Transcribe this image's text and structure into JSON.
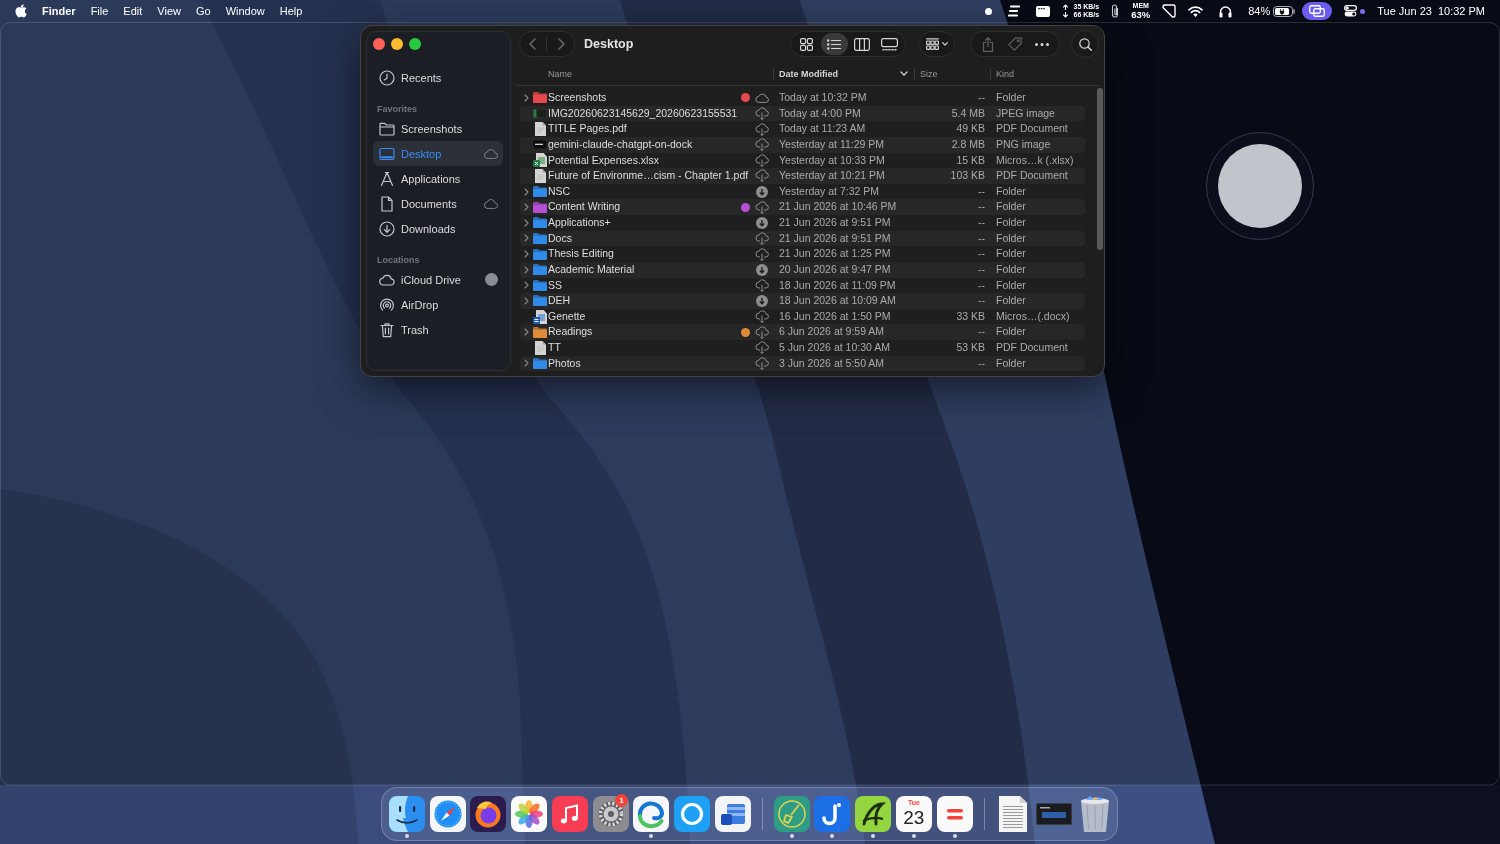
{
  "menu_bar": {
    "menus": [
      {
        "label": "Finder",
        "kind": "app"
      },
      {
        "label": "File",
        "kind": "menu"
      },
      {
        "label": "Edit",
        "kind": "menu"
      },
      {
        "label": "View",
        "kind": "menu"
      },
      {
        "label": "Go",
        "kind": "menu"
      },
      {
        "label": "Window",
        "kind": "menu"
      },
      {
        "label": "Help",
        "kind": "menu"
      }
    ],
    "status": {
      "network": {
        "upload": "35 KB/s",
        "download": "66 KB/s"
      },
      "memory": {
        "label": "MEM",
        "value": "63%"
      },
      "battery": {
        "percent": "84%",
        "charging": true
      },
      "mirroring": {
        "active": true
      },
      "date": "Tue Jun 23",
      "time": "10:32 PM"
    }
  },
  "window": {
    "title": "Desktop",
    "view_modes": [
      {
        "kind": "icons",
        "selected": false
      },
      {
        "kind": "list",
        "selected": true
      },
      {
        "kind": "columns",
        "selected": false
      },
      {
        "kind": "gallery",
        "selected": false
      }
    ]
  },
  "sidebar": {
    "sections": [
      {
        "items": [
          {
            "label": "Recents",
            "kind": "recents",
            "selected": false
          }
        ]
      },
      {
        "header": "Favorites",
        "items": [
          {
            "label": "Screenshots",
            "kind": "folder",
            "selected": false
          },
          {
            "label": "Desktop",
            "kind": "desktop",
            "selected": true,
            "badge": {
              "kind": "cloud"
            }
          },
          {
            "label": "Applications",
            "kind": "applications",
            "selected": false
          },
          {
            "label": "Documents",
            "kind": "documents",
            "selected": false,
            "badge": {
              "kind": "cloud"
            }
          },
          {
            "label": "Downloads",
            "kind": "downloads",
            "selected": false
          }
        ]
      },
      {
        "header": "Locations",
        "items": [
          {
            "label": "iCloud Drive",
            "kind": "icloud",
            "selected": false,
            "badge": {
              "kind": "progress"
            }
          },
          {
            "label": "AirDrop",
            "kind": "airdrop",
            "selected": false
          },
          {
            "label": "Trash",
            "kind": "trash",
            "selected": false
          }
        ]
      }
    ]
  },
  "table": {
    "columns": [
      {
        "label": "Name",
        "sorted": false
      },
      {
        "label": "Date Modified",
        "sorted": true
      },
      {
        "label": "Size",
        "sorted": false
      },
      {
        "label": "Kind",
        "sorted": false
      }
    ],
    "rows": [
      {
        "name": "Screenshots",
        "kind": "folder",
        "color": "#e5484d",
        "sync": {
          "kind": "cloud"
        },
        "date": "Today at 10:32 PM",
        "size": "--",
        "file_type": "Folder"
      },
      {
        "name": "IMG20260623145629_20260623155531",
        "kind": "photo",
        "sync": {
          "kind": "download"
        },
        "date": "Today at 4:00 PM",
        "size": "5.4 MB",
        "file_type": "JPEG image"
      },
      {
        "name": "TITLE Pages.pdf",
        "kind": "document",
        "sync": {
          "kind": "download"
        },
        "date": "Today at 11:23 AM",
        "size": "49 KB",
        "file_type": "PDF Document"
      },
      {
        "name": "gemini-claude-chatgpt-on-dock",
        "kind": "screenshot",
        "sync": {
          "kind": "download"
        },
        "date": "Yesterday at 11:29 PM",
        "size": "2.8 MB",
        "file_type": "PNG image"
      },
      {
        "name": "Potential Expenses.xlsx",
        "kind": "spreadsheet",
        "sync": {
          "kind": "download"
        },
        "date": "Yesterday at 10:33 PM",
        "size": "15 KB",
        "file_type": "Micros…k (.xlsx)"
      },
      {
        "name": "Future of Environme…cism - Chapter 1.pdf",
        "kind": "document",
        "sync": {
          "kind": "download"
        },
        "date": "Yesterday at 10:21 PM",
        "size": "103 KB",
        "file_type": "PDF Document"
      },
      {
        "name": "NSC",
        "kind": "folder",
        "sync": {
          "kind": "queued"
        },
        "date": "Yesterday at 7:32 PM",
        "size": "--",
        "file_type": "Folder"
      },
      {
        "name": "Content Writing",
        "kind": "folder",
        "color": "#b84fd8",
        "sync": {
          "kind": "download"
        },
        "date": "21 Jun 2026 at 10:46 PM",
        "size": "--",
        "file_type": "Folder"
      },
      {
        "name": "Applications+",
        "kind": "folder",
        "sync": {
          "kind": "queued"
        },
        "date": "21 Jun 2026 at 9:51 PM",
        "size": "--",
        "file_type": "Folder"
      },
      {
        "name": "Docs",
        "kind": "folder",
        "sync": {
          "kind": "download"
        },
        "date": "21 Jun 2026 at 9:51 PM",
        "size": "--",
        "file_type": "Folder"
      },
      {
        "name": "Thesis Editing",
        "kind": "folder",
        "sync": {
          "kind": "download"
        },
        "date": "21 Jun 2026 at 1:25 PM",
        "size": "--",
        "file_type": "Folder"
      },
      {
        "name": "Academic Material",
        "kind": "folder",
        "sync": {
          "kind": "queued"
        },
        "date": "20 Jun 2026 at 9:47 PM",
        "size": "--",
        "file_type": "Folder"
      },
      {
        "name": "SS",
        "kind": "folder",
        "sync": {
          "kind": "download"
        },
        "date": "18 Jun 2026 at 11:09 PM",
        "size": "--",
        "file_type": "Folder"
      },
      {
        "name": "DEH",
        "kind": "folder",
        "sync": {
          "kind": "queued"
        },
        "date": "18 Jun 2026 at 10:09 AM",
        "size": "--",
        "file_type": "Folder"
      },
      {
        "name": "Genette",
        "kind": "word",
        "sync": {
          "kind": "download"
        },
        "date": "16 Jun 2026 at 1:50 PM",
        "size": "33 KB",
        "file_type": "Micros…(.docx)"
      },
      {
        "name": "Readings",
        "kind": "folder",
        "color": "#e08a3c",
        "sync": {
          "kind": "download"
        },
        "date": "6 Jun 2026 at 9:59 AM",
        "size": "--",
        "file_type": "Folder"
      },
      {
        "name": "TT",
        "kind": "document",
        "sync": {
          "kind": "download"
        },
        "date": "5 Jun 2026 at 10:30 AM",
        "size": "53 KB",
        "file_type": "PDF Document"
      },
      {
        "name": "Photos",
        "kind": "folder",
        "sync": {
          "kind": "download"
        },
        "date": "3 Jun 2026 at 5:50 AM",
        "size": "--",
        "file_type": "Folder"
      }
    ]
  },
  "dock": {
    "sections": [
      {
        "items": [
          {
            "kind": "face",
            "running": true
          },
          {
            "kind": "compass",
            "running": false
          },
          {
            "kind": "fox",
            "running": false
          },
          {
            "kind": "flower",
            "running": false
          },
          {
            "kind": "note",
            "running": false
          },
          {
            "kind": "gear",
            "running": false,
            "badge": "1"
          },
          {
            "kind": "swirl",
            "running": true
          },
          {
            "kind": "ring",
            "running": false
          },
          {
            "kind": "pages",
            "running": false
          }
        ]
      },
      {
        "items": [
          {
            "kind": "broom",
            "running": true
          },
          {
            "kind": "hook",
            "running": true
          },
          {
            "kind": "swoosh",
            "running": true
          },
          {
            "kind": "calendar",
            "running": true,
            "weekday": "Tue",
            "day": "23"
          },
          {
            "kind": "equals",
            "running": true
          }
        ]
      },
      {
        "items": [
          {
            "kind": "page",
            "running": false
          },
          {
            "kind": "screenshot",
            "running": false
          },
          {
            "kind": "trash",
            "running": false
          }
        ]
      }
    ]
  }
}
